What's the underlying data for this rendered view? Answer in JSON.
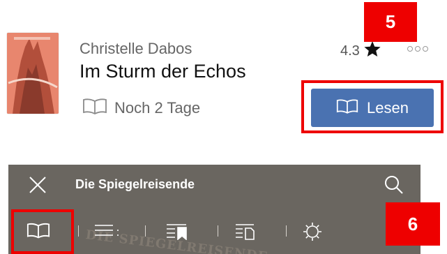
{
  "book": {
    "author": "Christelle Dabos",
    "title": "Im Sturm der Echos",
    "loan_status": "Noch 2 Tage",
    "rating": "4.3",
    "read_button_label": "Lesen",
    "icons": {
      "loan": "book-open-icon",
      "star": "star-icon",
      "more": "more-dots-icon"
    }
  },
  "annotations": {
    "step_a": "5",
    "step_b": "6",
    "highlight_color": "#ee0000"
  },
  "reader": {
    "title": "Die Spiegelreisende",
    "background_text": "DIE SPIEGELREISENDE",
    "tabs": [
      {
        "icon": "book-open-icon"
      },
      {
        "icon": "list-icon"
      },
      {
        "icon": "bookmark-list-icon"
      },
      {
        "icon": "page-list-icon"
      },
      {
        "icon": "settings-gear-icon"
      }
    ],
    "colors": {
      "bar": "#6a6660",
      "accent_button": "#4a72b1"
    }
  }
}
